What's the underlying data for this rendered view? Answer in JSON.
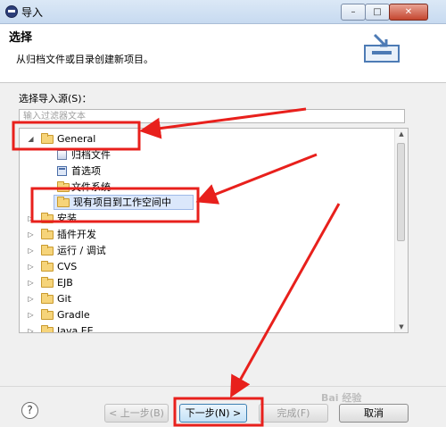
{
  "window": {
    "title": "导入",
    "controls": {
      "minimize": "–",
      "maximize": "□",
      "close": "✕"
    }
  },
  "header": {
    "title": "选择",
    "description": "从归档文件或目录创建新项目。",
    "icon": "import-wizard-icon"
  },
  "source": {
    "label": "选择导入源(S)：",
    "filter_placeholder": "输入过滤器文本"
  },
  "tree": {
    "items": [
      {
        "label": "General",
        "icon": "folder-open-icon",
        "expanded": true,
        "level": 0
      },
      {
        "label": "归档文件",
        "icon": "archive-icon",
        "level": 1
      },
      {
        "label": "首选项",
        "icon": "preferences-icon",
        "level": 1
      },
      {
        "label": "文件系统",
        "icon": "folder-icon",
        "level": 1
      },
      {
        "label": "现有项目到工作空间中",
        "icon": "folder-open-icon",
        "level": 1,
        "selected": true
      },
      {
        "label": "安装",
        "icon": "folder-icon",
        "level": 0
      },
      {
        "label": "插件开发",
        "icon": "folder-icon",
        "level": 0
      },
      {
        "label": "运行 / 调试",
        "icon": "folder-icon",
        "level": 0
      },
      {
        "label": "CVS",
        "icon": "folder-icon",
        "level": 0
      },
      {
        "label": "EJB",
        "icon": "folder-icon",
        "level": 0
      },
      {
        "label": "Git",
        "icon": "folder-icon",
        "level": 0
      },
      {
        "label": "Gradle",
        "icon": "folder-icon",
        "level": 0
      },
      {
        "label": "Java EE",
        "icon": "folder-icon",
        "level": 0
      }
    ]
  },
  "buttons": {
    "help": "?",
    "back": "< 上一步(B)",
    "next": "下一步(N) >",
    "finish": "完成(F)",
    "cancel": "取消"
  },
  "watermark": "Bai 经验",
  "colors": {
    "annotation_red": "#e8201c",
    "selection": "#dbe7fb"
  }
}
